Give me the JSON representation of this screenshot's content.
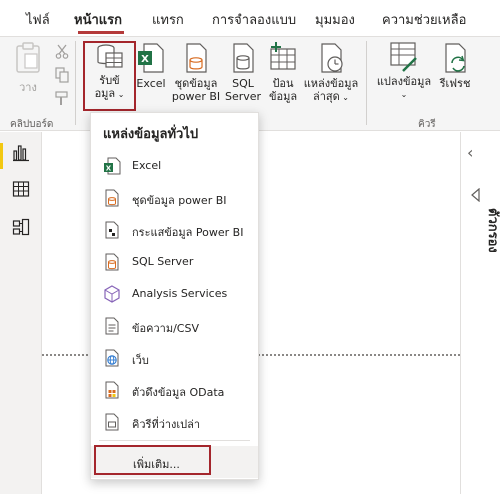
{
  "tabs": [
    {
      "label": "ไฟล์"
    },
    {
      "label": "หน้าแรก",
      "active": true
    },
    {
      "label": "แทรก"
    },
    {
      "label": "การจำลองแบบ"
    },
    {
      "label": "มุมมอง"
    },
    {
      "label": "ความช่วยเหลือ"
    }
  ],
  "ribbon": {
    "clipboard": {
      "paste_label": "วาง",
      "group_label": "คลิปบอร์ด"
    },
    "get_data": {
      "label_line1": "รับข้",
      "label_line2": "อมูล"
    },
    "excel": {
      "label": "Excel"
    },
    "dataset": {
      "label_line1": "ชุดข้อมูล",
      "label_line2": "power BI"
    },
    "sql": {
      "label_line1": "SQL",
      "label_line2": "Server"
    },
    "enter_data": {
      "label_line1": "ป้อน",
      "label_line2": "ข้อมูล"
    },
    "recent": {
      "label_line1": "แหล่งข้อมูล",
      "label_line2": "ล่าสุด"
    },
    "transform": {
      "label": "แปลงข้อมูล"
    },
    "refresh": {
      "label": "รีเฟรช"
    },
    "queries": {
      "group_label": "คิวรี"
    }
  },
  "right_pane": {
    "label": "ตัวกรอง"
  },
  "dropdown": {
    "title": "แหล่งข้อมูลทั่วไป",
    "items": [
      {
        "label": "Excel",
        "icon": "excel-icon"
      },
      {
        "label": "ชุดข้อมูล power BI",
        "icon": "dataset-icon"
      },
      {
        "label": "กระแสข้อมูล Power BI",
        "icon": "dataflow-icon"
      },
      {
        "label": "SQL Server",
        "icon": "sql-server-icon"
      },
      {
        "label": "Analysis Services",
        "icon": "analysis-services-icon"
      },
      {
        "label": "ข้อความ/CSV",
        "icon": "text-csv-icon"
      },
      {
        "label": "เว็บ",
        "icon": "web-icon"
      },
      {
        "label": "ตัวดึงข้อมูล OData",
        "icon": "odata-icon"
      },
      {
        "label": "คิวรีที่ว่างเปล่า",
        "icon": "blank-query-icon"
      }
    ],
    "more_label": "เพิ่มเติม..."
  },
  "colors": {
    "accent": "#a4262c",
    "excel_green": "#217346",
    "powerbi_yellow": "#f2c811",
    "orange": "#d86b20"
  }
}
